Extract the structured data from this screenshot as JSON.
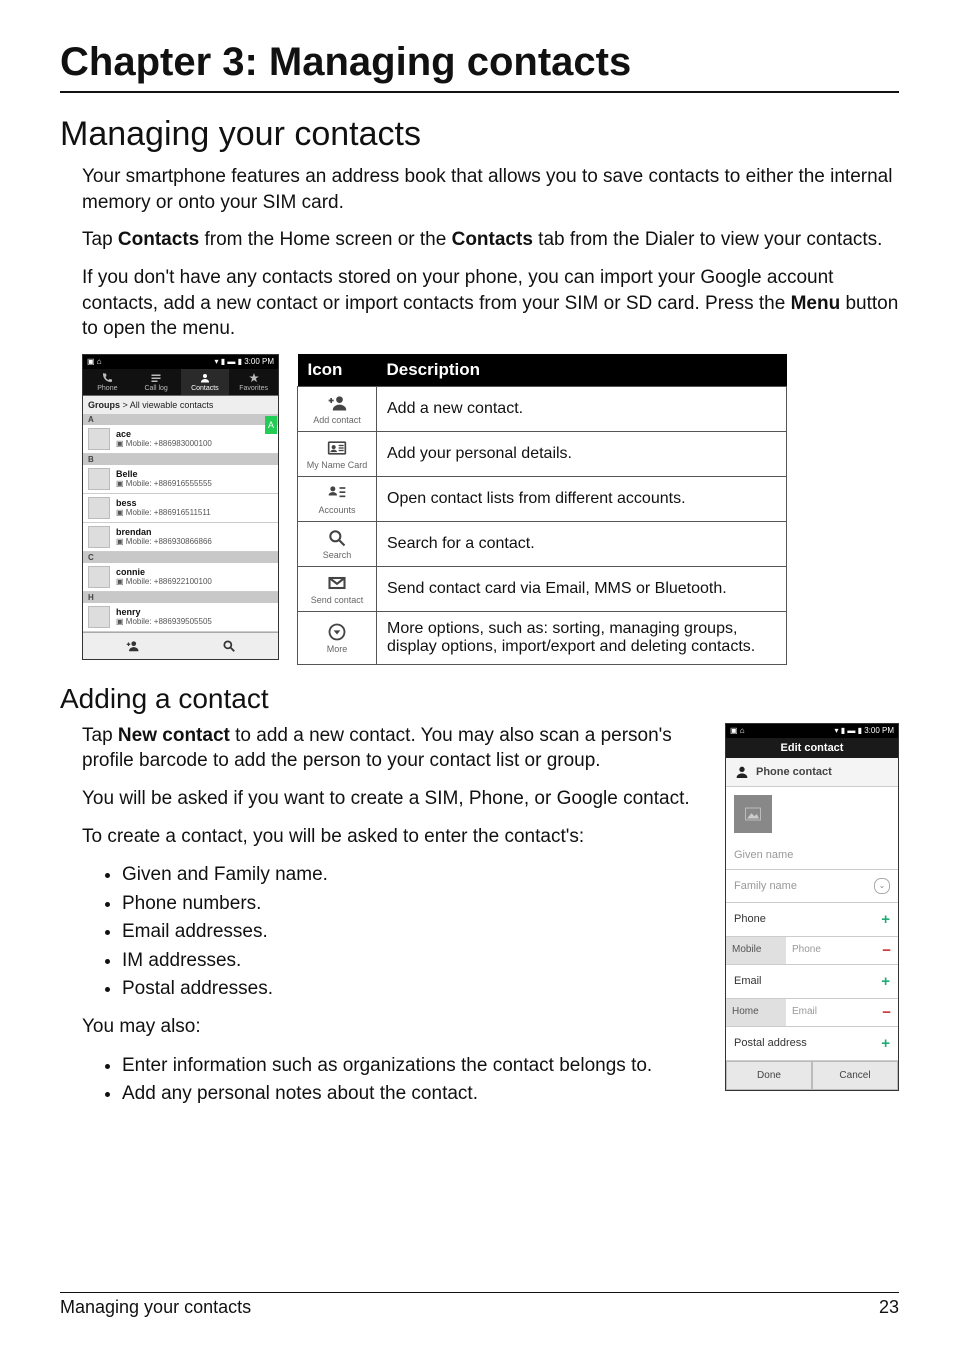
{
  "chapter_title": "Chapter 3: Managing contacts",
  "section_title": "Managing your contacts",
  "intro_p1": "Your smartphone features an address book that allows you to save contacts to either the internal memory or onto your SIM card.",
  "intro_p2a": "Tap ",
  "intro_p2b": "Contacts",
  "intro_p2c": " from the Home screen or the ",
  "intro_p2d": "Contacts",
  "intro_p2e": " tab from the Dialer to view your contacts.",
  "intro_p3a": "If you don't have any contacts stored on your phone, you can import your Google account contacts, add a new contact or import contacts from your SIM or SD card. Press the ",
  "intro_p3b": "Menu",
  "intro_p3c": " button to open the menu.",
  "status_time": "3:00 PM",
  "tabs": {
    "phone": "Phone",
    "calllog": "Call log",
    "contacts": "Contacts",
    "favorites": "Favorites"
  },
  "filterbar_a": "Groups",
  "filterbar_b": "> All viewable contacts",
  "scroll_letter": "A",
  "sections": [
    "A",
    "B",
    "C",
    "H"
  ],
  "contacts_A": [
    {
      "name": "ace",
      "phone": "Mobile: +886983000100"
    }
  ],
  "contacts_B": [
    {
      "name": "Belle",
      "phone": "Mobile: +886916555555"
    },
    {
      "name": "bess",
      "phone": "Mobile: +886916511511"
    },
    {
      "name": "brendan",
      "phone": "Mobile: +886930866866"
    }
  ],
  "contacts_C": [
    {
      "name": "connie",
      "phone": "Mobile: +886922100100"
    }
  ],
  "contacts_H": [
    {
      "name": "henry",
      "phone": "Mobile: +886939505505"
    }
  ],
  "table": {
    "h1": "Icon",
    "h2": "Description",
    "rows": [
      {
        "label": "Add contact",
        "desc": "Add a new contact."
      },
      {
        "label": "My Name Card",
        "desc": "Add your personal details."
      },
      {
        "label": "Accounts",
        "desc": "Open contact lists from different accounts."
      },
      {
        "label": "Search",
        "desc": "Search for a contact."
      },
      {
        "label": "Send contact",
        "desc": "Send contact card via Email, MMS or Bluetooth."
      },
      {
        "label": "More",
        "desc": "More options, such as: sorting, managing groups, display options, import/export and deleting contacts."
      }
    ]
  },
  "subsection_title": "Adding a contact",
  "add_p1a": "Tap ",
  "add_p1b": "New contact",
  "add_p1c": " to add a new contact. You may also scan a person's profile barcode to add the person to your contact list or group.",
  "add_p2": "You will be asked if you want to create a SIM, Phone, or Google contact.",
  "add_p3": "To create a contact, you will be asked to enter the contact's:",
  "bullets1": [
    "Given and Family name.",
    "Phone numbers.",
    "Email addresses.",
    "IM addresses.",
    "Postal addresses."
  ],
  "add_p4": "You may also:",
  "bullets2": [
    "Enter information such as organizations the contact belongs to.",
    "Add any personal notes about the contact."
  ],
  "edit_screen": {
    "title": "Edit contact",
    "type": "Phone contact",
    "given": "Given name",
    "family": "Family name",
    "phone_sec": "Phone",
    "phone_type": "Mobile",
    "phone_ph": "Phone",
    "email_sec": "Email",
    "email_type": "Home",
    "email_ph": "Email",
    "postal_sec": "Postal address",
    "done": "Done",
    "cancel": "Cancel"
  },
  "footer_left": "Managing your contacts",
  "footer_right": "23"
}
